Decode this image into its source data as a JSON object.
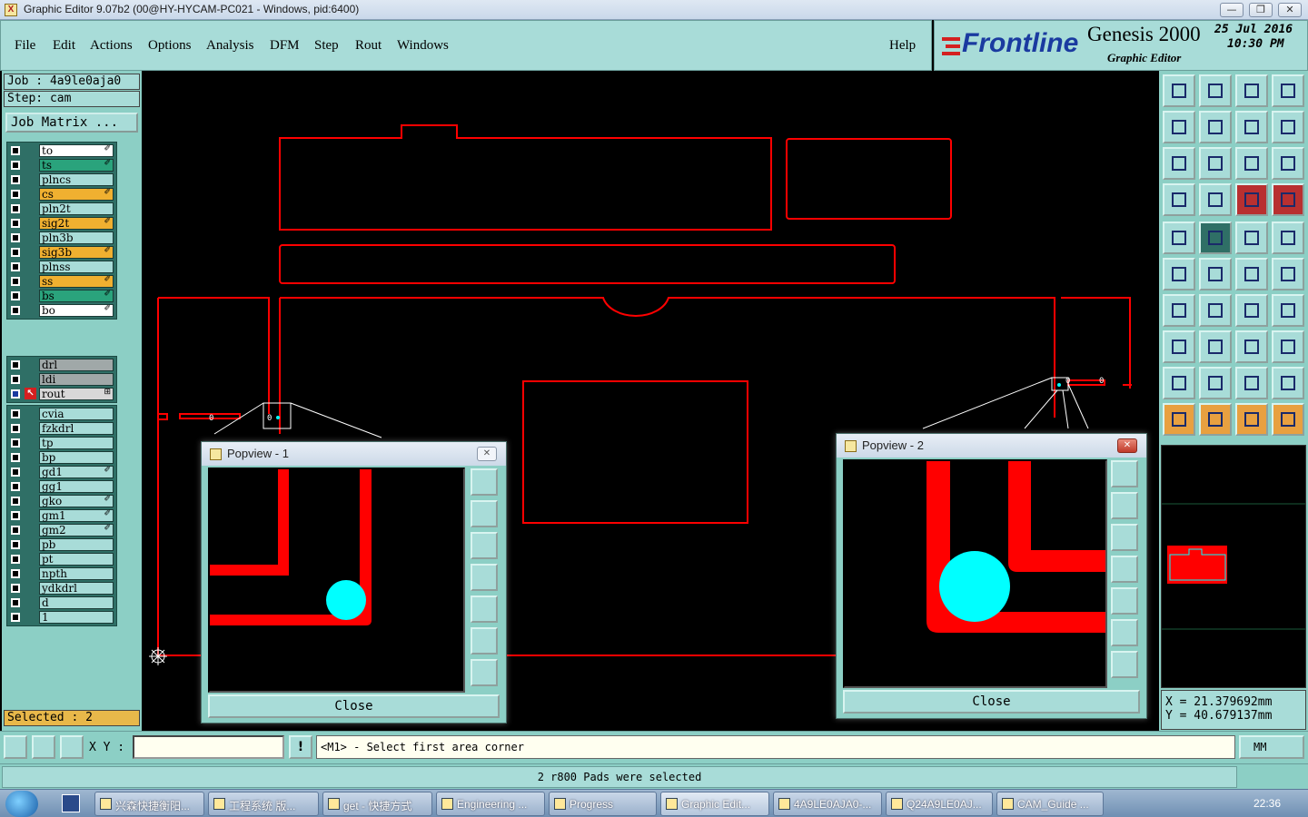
{
  "window": {
    "title": "Graphic Editor 9.07b2 (00@HY-HYCAM-PC021 - Windows, pid:6400)",
    "min": "—",
    "max": "❐",
    "close": "✕"
  },
  "menu": {
    "items": [
      "File",
      "Edit",
      "Actions",
      "Options",
      "Analysis",
      "DFM",
      "Step",
      "Rout",
      "Windows"
    ],
    "help": "Help"
  },
  "logo": {
    "brand": "Frontline",
    "product": "Genesis 2000",
    "subtitle": "Graphic Editor",
    "date": "25 Jul 2016",
    "time": "10:30 PM"
  },
  "job": {
    "job": "Job : 4a9le0aja0",
    "step": "Step: cam",
    "matrix_button": "Job Matrix ..."
  },
  "layers_group1": [
    {
      "name": "to",
      "color": "#ffffff",
      "flag": "✐"
    },
    {
      "name": "ts",
      "color": "#2aa37c",
      "flag": "✐"
    },
    {
      "name": "plncs",
      "color": "#a8dcd8",
      "flag": ""
    },
    {
      "name": "cs",
      "color": "#f0b030",
      "flag": "✐"
    },
    {
      "name": "pln2t",
      "color": "#a8dcd8",
      "flag": ""
    },
    {
      "name": "sig2t",
      "color": "#f0b030",
      "flag": "✐"
    },
    {
      "name": "pln3b",
      "color": "#a8dcd8",
      "flag": ""
    },
    {
      "name": "sig3b",
      "color": "#f0b030",
      "flag": "✐"
    },
    {
      "name": "plnss",
      "color": "#a8dcd8",
      "flag": ""
    },
    {
      "name": "ss",
      "color": "#f0b030",
      "flag": "✐"
    },
    {
      "name": "bs",
      "color": "#2aa37c",
      "flag": "✐"
    },
    {
      "name": "bo",
      "color": "#ffffff",
      "flag": "✐"
    }
  ],
  "layers_group2": [
    {
      "name": "drl",
      "color": "#a0a8a8",
      "flag": ""
    },
    {
      "name": "ldi",
      "color": "#a0a8a8",
      "flag": ""
    },
    {
      "name": "rout",
      "color": "#d8d8d8",
      "flag": "⊞"
    }
  ],
  "layers_group3": [
    {
      "name": "cvia",
      "color": "#a8dcd8",
      "flag": ""
    },
    {
      "name": "fzkdrl",
      "color": "#a8dcd8",
      "flag": ""
    },
    {
      "name": "tp",
      "color": "#a8dcd8",
      "flag": ""
    },
    {
      "name": "bp",
      "color": "#a8dcd8",
      "flag": ""
    },
    {
      "name": "gd1",
      "color": "#a8dcd8",
      "flag": "✐"
    },
    {
      "name": "gg1",
      "color": "#a8dcd8",
      "flag": ""
    },
    {
      "name": "gko",
      "color": "#a8dcd8",
      "flag": "✐"
    },
    {
      "name": "gm1",
      "color": "#a8dcd8",
      "flag": "✐"
    },
    {
      "name": "gm2",
      "color": "#a8dcd8",
      "flag": "✐"
    },
    {
      "name": "pb",
      "color": "#a8dcd8",
      "flag": ""
    },
    {
      "name": "pt",
      "color": "#a8dcd8",
      "flag": ""
    },
    {
      "name": "npth",
      "color": "#a8dcd8",
      "flag": ""
    },
    {
      "name": "ydkdrl",
      "color": "#a8dcd8",
      "flag": ""
    },
    {
      "name": "d",
      "color": "#a8dcd8",
      "flag": ""
    },
    {
      "name": "1",
      "color": "#a8dcd8",
      "flag": ""
    }
  ],
  "selected": "Selected : 2",
  "popview1": {
    "title": "Popview - 1",
    "close": "Close"
  },
  "popview2": {
    "title": "Popview - 2",
    "close": "Close"
  },
  "coords": {
    "x": "X = 21.379692mm",
    "y": "Y = 40.679137mm"
  },
  "command": {
    "xy_label": "X Y :",
    "input_value": "",
    "prompt": "<M1> - Select first area corner",
    "units": "MM",
    "excl": "!"
  },
  "status": "2 r800 Pads were selected",
  "taskbar": {
    "items": [
      "兴森快捷衡阳...",
      "工程系统  版...",
      "get - 快捷方式",
      "Engineering ...",
      "Progress",
      "Graphic Edit...",
      "4A9LE0AJA0-...",
      "Q24A9LE0AJ...",
      "CAM_Guide ..."
    ],
    "clock": "22:36"
  },
  "colors": {
    "outline": "#ff0000",
    "pad": "#00ffff",
    "panel": "#8ccfc5",
    "field": "#a8dcd8"
  }
}
